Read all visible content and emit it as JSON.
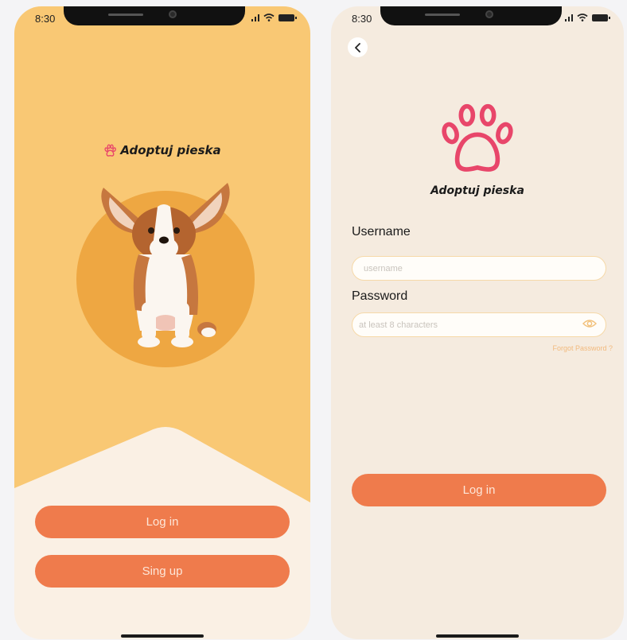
{
  "status_bar": {
    "time": "8:30"
  },
  "brand": {
    "name": "Adoptuj pieska"
  },
  "welcome": {
    "login_label": "Log in",
    "signup_label": "Sing up"
  },
  "login": {
    "username_label": "Username",
    "username_placeholder": "username",
    "password_label": "Password",
    "password_placeholder": "at least 8 characters",
    "forgot_label": "Forgot Password ?",
    "submit_label": "Log in"
  },
  "icons": {
    "back": "chevron-left-icon",
    "paw": "paw-icon",
    "eye": "eye-icon",
    "signal": "signal-icon",
    "wifi": "wifi-icon",
    "battery": "battery-icon"
  },
  "colors": {
    "welcome_top": "#f9c874",
    "welcome_bottom": "#faf0e4",
    "dog_circle": "#eea742",
    "button": "#ef7b4c",
    "button_text": "#fde6d8",
    "paw": "#e8466a",
    "login_bg": "#f5ebdf",
    "input_border": "#f6d9a8",
    "forgot_text": "#f2ba7e"
  }
}
